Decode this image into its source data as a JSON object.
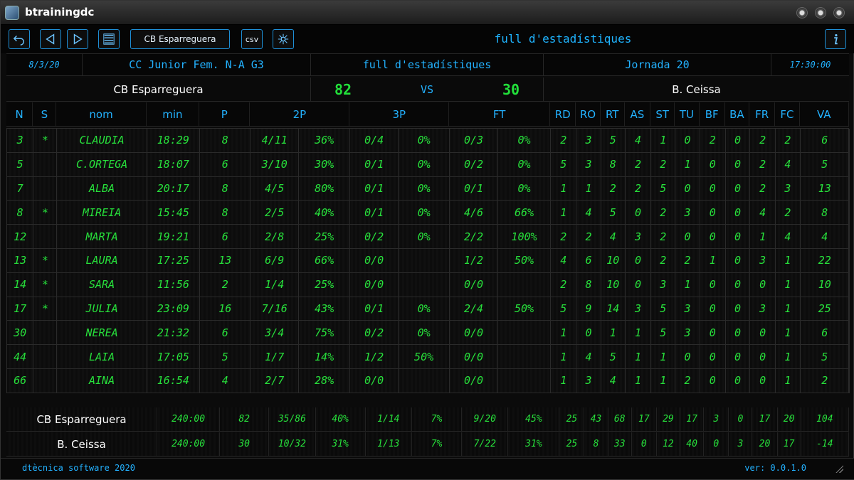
{
  "window": {
    "title": "btrainingdc"
  },
  "toolbar": {
    "team_button_label": "CB Esparreguera",
    "csv_label": "csv",
    "title": "full d'estadístiques"
  },
  "info": {
    "date": "8/3/20",
    "competition": "CC Junior Fem. N-A G3",
    "mode": "full d'estadístiques",
    "round": "Jornada 20",
    "time": "17:30:00"
  },
  "teams": {
    "home_name": "CB Esparreguera",
    "home_score": "82",
    "vs_label": "VS",
    "away_score": "30",
    "away_name": "B. Ceissa"
  },
  "columns": [
    "N",
    "S",
    "nom",
    "min",
    "P",
    "2P",
    "3P",
    "FT",
    "RD",
    "RO",
    "RT",
    "AS",
    "ST",
    "TU",
    "BF",
    "BA",
    "FR",
    "FC",
    "VA"
  ],
  "players": [
    [
      "3",
      "*",
      "CLAUDIA",
      "18:29",
      "8",
      "4/11",
      "36%",
      "0/4",
      "0%",
      "0/3",
      "0%",
      "2",
      "3",
      "5",
      "4",
      "1",
      "0",
      "2",
      "0",
      "2",
      "2",
      "6"
    ],
    [
      "5",
      "",
      "C.ORTEGA",
      "18:07",
      "6",
      "3/10",
      "30%",
      "0/1",
      "0%",
      "0/2",
      "0%",
      "5",
      "3",
      "8",
      "2",
      "2",
      "1",
      "0",
      "0",
      "2",
      "4",
      "5"
    ],
    [
      "7",
      "",
      "ALBA",
      "20:17",
      "8",
      "4/5",
      "80%",
      "0/1",
      "0%",
      "0/1",
      "0%",
      "1",
      "1",
      "2",
      "2",
      "5",
      "0",
      "0",
      "0",
      "2",
      "3",
      "13"
    ],
    [
      "8",
      "*",
      "MIREIA",
      "15:45",
      "8",
      "2/5",
      "40%",
      "0/1",
      "0%",
      "4/6",
      "66%",
      "1",
      "4",
      "5",
      "0",
      "2",
      "3",
      "0",
      "0",
      "4",
      "2",
      "8"
    ],
    [
      "12",
      "",
      "MARTA",
      "19:21",
      "6",
      "2/8",
      "25%",
      "0/2",
      "0%",
      "2/2",
      "100%",
      "2",
      "2",
      "4",
      "3",
      "2",
      "0",
      "0",
      "0",
      "1",
      "4",
      "4"
    ],
    [
      "13",
      "*",
      "LAURA",
      "17:25",
      "13",
      "6/9",
      "66%",
      "0/0",
      "",
      "1/2",
      "50%",
      "4",
      "6",
      "10",
      "0",
      "2",
      "2",
      "1",
      "0",
      "3",
      "1",
      "22"
    ],
    [
      "14",
      "*",
      "SARA",
      "11:56",
      "2",
      "1/4",
      "25%",
      "0/0",
      "",
      "0/0",
      "",
      "2",
      "8",
      "10",
      "0",
      "3",
      "1",
      "0",
      "0",
      "0",
      "1",
      "10"
    ],
    [
      "17",
      "*",
      "JULIA",
      "23:09",
      "16",
      "7/16",
      "43%",
      "0/1",
      "0%",
      "2/4",
      "50%",
      "5",
      "9",
      "14",
      "3",
      "5",
      "3",
      "0",
      "0",
      "3",
      "1",
      "25"
    ],
    [
      "30",
      "",
      "NEREA",
      "21:32",
      "6",
      "3/4",
      "75%",
      "0/2",
      "0%",
      "0/0",
      "",
      "1",
      "0",
      "1",
      "1",
      "5",
      "3",
      "0",
      "0",
      "0",
      "1",
      "6"
    ],
    [
      "44",
      "",
      "LAIA",
      "17:05",
      "5",
      "1/7",
      "14%",
      "1/2",
      "50%",
      "0/0",
      "",
      "1",
      "4",
      "5",
      "1",
      "1",
      "0",
      "0",
      "0",
      "0",
      "1",
      "5"
    ],
    [
      "66",
      "",
      "AINA",
      "16:54",
      "4",
      "2/7",
      "28%",
      "0/0",
      "",
      "0/0",
      "",
      "1",
      "3",
      "4",
      "1",
      "1",
      "2",
      "0",
      "0",
      "0",
      "1",
      "2"
    ]
  ],
  "totals": [
    [
      "CB Esparreguera",
      "240:00",
      "82",
      "35/86",
      "40%",
      "1/14",
      "7%",
      "9/20",
      "45%",
      "25",
      "43",
      "68",
      "17",
      "29",
      "17",
      "3",
      "0",
      "17",
      "20",
      "104"
    ],
    [
      "B. Ceissa",
      "240:00",
      "30",
      "10/32",
      "31%",
      "1/13",
      "7%",
      "7/22",
      "31%",
      "25",
      "8",
      "33",
      "0",
      "12",
      "40",
      "0",
      "3",
      "20",
      "17",
      "-14"
    ]
  ],
  "footer": {
    "credits": "dtècnica software 2020",
    "version": "ver: 0.0.1.0"
  },
  "colors": {
    "accent": "#23b2ff",
    "digits": "#27e03b"
  },
  "icons": {
    "undo": "undo-icon",
    "prev": "prev-icon",
    "next": "next-icon",
    "list": "list-icon",
    "network": "network-icon",
    "info": "info-icon"
  }
}
